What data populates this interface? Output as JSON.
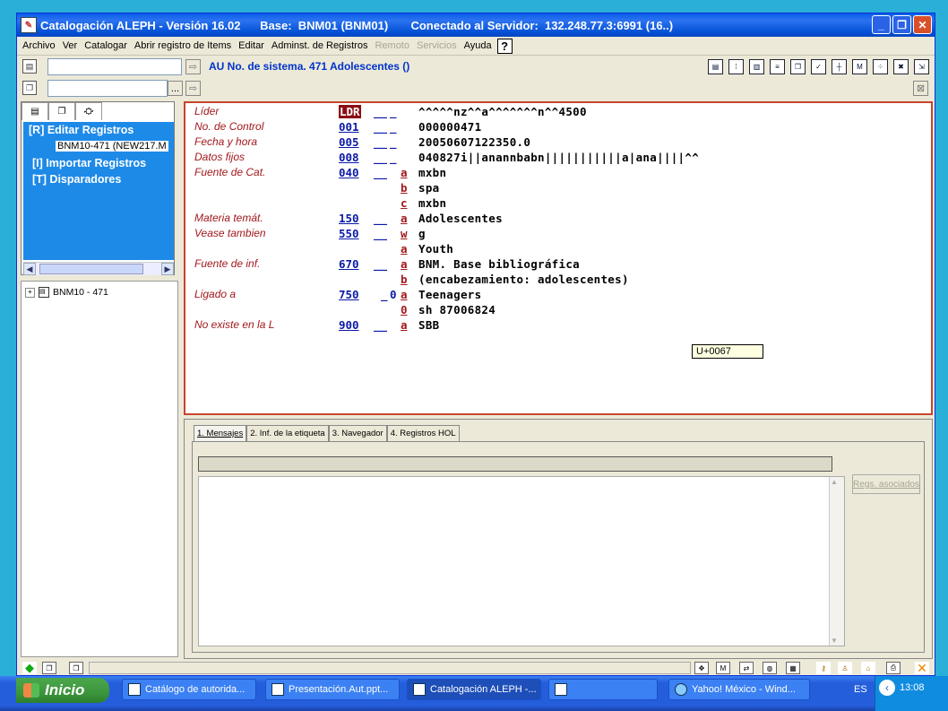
{
  "window": {
    "title": "Catalogación ALEPH - Versión 16.02      Base:  BNM01 (BNM01)       Conectado al Servidor:  132.248.77.3:6991 (16..)",
    "minimize_icon": "minimize-icon",
    "maximize_icon": "restore-icon",
    "close_icon": "close-icon"
  },
  "menu": {
    "items": [
      "Archivo",
      "Ver",
      "Catalogar",
      "Abrir registro de Items",
      "Editar",
      "Adminst. de Registros"
    ],
    "disabled_items": [
      "Remoto",
      "Servicios"
    ],
    "help_label": "Ayuda",
    "help_button": "?"
  },
  "toolbar": {
    "record_info": "AU No. de sistema. 471 Adolescentes ()",
    "search_value": "",
    "second_search_value": "",
    "browse_button": "...",
    "arrow_glyph": "⇨"
  },
  "left_panel": {
    "tree_items": [
      "[R] Editar Registros",
      "BNM10-471 (NEW217.M",
      "[I] Importar Registros",
      "[T] Disparadores"
    ],
    "scroll_thumb_glyph": "|||",
    "lower_tree": "BNM10 - 471"
  },
  "editor": {
    "rows": [
      {
        "label": "Líder",
        "tag": "LDR",
        "ind1": "__",
        "ind2": "_",
        "sub": "",
        "value": "^^^^^nz^^a^^^^^^^n^^4500"
      },
      {
        "label": "No. de Control",
        "tag": "001",
        "ind1": "__",
        "ind2": "_",
        "sub": "",
        "value": "000000471"
      },
      {
        "label": "Fecha y hora",
        "tag": "005",
        "ind1": "__",
        "ind2": "_",
        "sub": "",
        "value": "20050607122350.0"
      },
      {
        "label": "Datos fijos",
        "tag": "008",
        "ind1": "__",
        "ind2": "_",
        "sub": "",
        "value": "040827i||anannbabn|||||||||||a|ana||||^^"
      },
      {
        "label": "Fuente de Cat.",
        "tag": "040",
        "ind1": "__",
        "ind2": "",
        "sub": "a",
        "value": "mxbn"
      },
      {
        "label": "",
        "tag": "",
        "ind1": "",
        "ind2": "",
        "sub": "b",
        "value": "spa"
      },
      {
        "label": "",
        "tag": "",
        "ind1": "",
        "ind2": "",
        "sub": "c",
        "value": "mxbn"
      },
      {
        "label": "Materia temát.",
        "tag": "150",
        "ind1": "__",
        "ind2": "",
        "sub": "a",
        "value": "Adolescentes"
      },
      {
        "label": "Vease tambien",
        "tag": "550",
        "ind1": "__",
        "ind2": "",
        "sub": "w",
        "value": "g"
      },
      {
        "label": "",
        "tag": "",
        "ind1": "",
        "ind2": "",
        "sub": "a",
        "value": "Youth"
      },
      {
        "label": "Fuente de inf.",
        "tag": "670",
        "ind1": "__",
        "ind2": "",
        "sub": "a",
        "value": "BNM. Base bibliográfica"
      },
      {
        "label": "",
        "tag": "",
        "ind1": "",
        "ind2": "",
        "sub": "b",
        "value": "(encabezamiento: adolescentes)"
      },
      {
        "label": "Ligado a",
        "tag": "750",
        "ind1": "_",
        "ind2": "0",
        "sub": "a",
        "value": "Teenagers"
      },
      {
        "label": "",
        "tag": "",
        "ind1": "",
        "ind2": "",
        "sub": "0",
        "value": "sh 87006824"
      },
      {
        "label": "No existe en la L",
        "tag": "900",
        "ind1": "__",
        "ind2": "",
        "sub": "a",
        "value": "SBB"
      }
    ],
    "tooltip": "U+0067"
  },
  "bottom_panel": {
    "tabs": [
      "1. Mensajes",
      "2. Inf. de la etiqueta",
      "3. Navegador",
      "4. Registros HOL"
    ],
    "regs_button": "Regs. asociados",
    "scroll_up": "▲",
    "scroll_down": "▼"
  },
  "taskbar": {
    "start_label": "Inicio",
    "tasks": [
      "Catálogo de autorida...",
      "Presentación.Aut.ppt...",
      "Catalogación ALEPH -...",
      "",
      "Yahoo! México - Wind..."
    ],
    "lang": "ES",
    "clock": "13:08"
  },
  "colors": {
    "titlebar": "#0a5ee8",
    "editor_border": "#c8442c",
    "label_red": "#a2181c",
    "tag_blue": "#0a1aa6",
    "tree_blue": "#1e8ae8"
  }
}
